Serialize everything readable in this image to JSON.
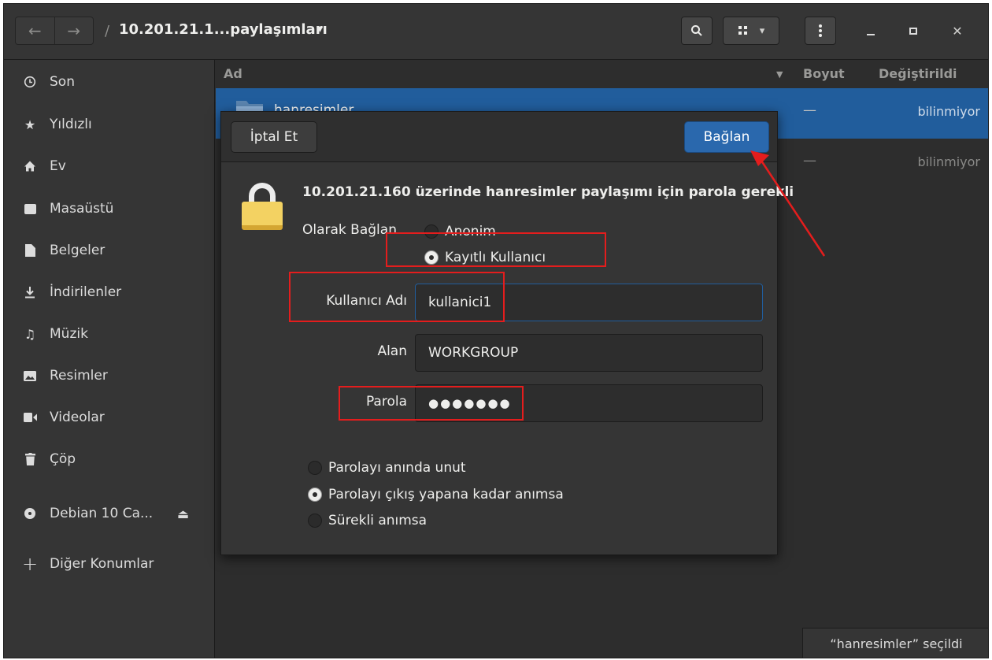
{
  "header": {
    "back_icon": "←",
    "forward_icon": "→",
    "path_separator": "/",
    "path_label": "10.201.21.1...paylaşımları",
    "path_dropdown_icon": "▾",
    "search_icon": "🔍",
    "view_icon": "⠿",
    "view_dropdown_icon": "▾",
    "menu_icon": "⋮",
    "minimize_icon": "–",
    "maximize_icon": "▫",
    "close_icon": "✕"
  },
  "sidebar": {
    "items": [
      {
        "label": "Son",
        "icon": "clock-icon"
      },
      {
        "label": "Yıldızlı",
        "icon": "star-icon"
      },
      {
        "label": "Ev",
        "icon": "home-icon"
      },
      {
        "label": "Masaüstü",
        "icon": "desktop-icon"
      },
      {
        "label": "Belgeler",
        "icon": "document-icon"
      },
      {
        "label": "İndirilenler",
        "icon": "download-icon"
      },
      {
        "label": "Müzik",
        "icon": "music-icon"
      },
      {
        "label": "Resimler",
        "icon": "picture-icon"
      },
      {
        "label": "Videolar",
        "icon": "video-icon"
      },
      {
        "label": "Çöp",
        "icon": "trash-icon"
      },
      {
        "label": "Debian 10 Ca...",
        "icon": "disc-icon"
      },
      {
        "label": "Diğer Konumlar",
        "icon": "plus-icon"
      }
    ],
    "eject_icon": "⏏"
  },
  "files": {
    "columns": {
      "name": "Ad",
      "size": "Boyut",
      "modified": "Değiştirildi"
    },
    "rows": [
      {
        "name": "hanresimler",
        "size": "—",
        "modified": "bilinmiyor"
      },
      {
        "name": "",
        "size": "—",
        "modified": "bilinmiyor"
      }
    ],
    "status": "“hanresimler” seçildi"
  },
  "dialog": {
    "cancel_label": "İptal Et",
    "connect_label": "Bağlan",
    "title": "10.201.21.160 üzerinde hanresimler paylaşımı için parola gerekli",
    "connect_as_label": "Olarak Bağlan",
    "connect_as_options": [
      "Anonim",
      "Kayıtlı Kullanıcı"
    ],
    "connect_as_selected": "Kayıtlı Kullanıcı",
    "username_label": "Kullanıcı Adı",
    "username_value": "kullanici1",
    "domain_label": "Alan",
    "domain_value": "WORKGROUP",
    "password_label": "Parola",
    "password_value": "●●●●●●●",
    "remember_options": [
      "Parolayı anında unut",
      "Parolayı çıkış yapana kadar anımsa",
      "Sürekli anımsa"
    ],
    "remember_selected": "Parolayı çıkış yapana kadar anımsa"
  },
  "colors": {
    "accent": "#2a68ad",
    "selection": "#215d9c",
    "annotation": "#e41d1d",
    "lock": "#f3d262"
  }
}
